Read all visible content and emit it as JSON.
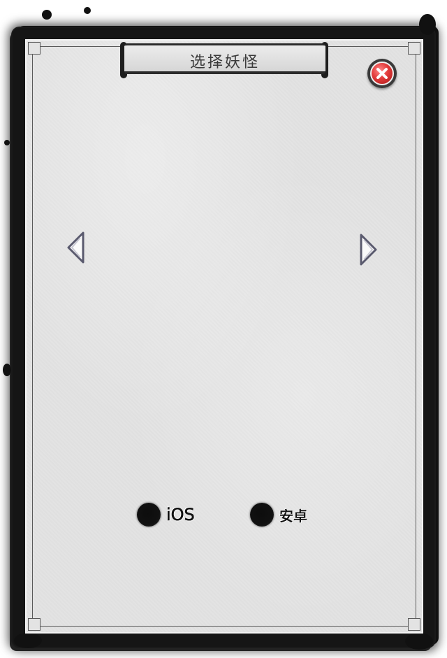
{
  "dialog": {
    "title": "选择妖怪"
  },
  "navigation": {
    "previous_icon": "left-triangle-arrow-icon",
    "next_icon": "right-triangle-arrow-icon",
    "close_icon": "close-x-icon"
  },
  "platform_options": [
    {
      "label": "iOS",
      "selected": true
    },
    {
      "label": "安卓",
      "selected": true
    }
  ],
  "colors": {
    "ink": "#151515",
    "paper": "#e3e3e3",
    "close_red": "#e23a3a"
  }
}
